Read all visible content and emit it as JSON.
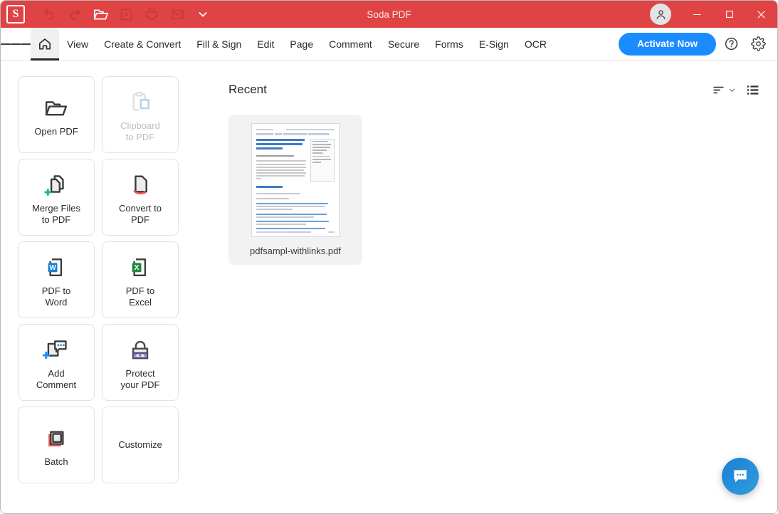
{
  "window": {
    "title": "Soda PDF",
    "app_badge": "S",
    "accent_red": "#e04344",
    "accent_blue": "#1a8cff",
    "minimize_label": "Minimize",
    "maximize_label": "Maximize",
    "close_label": "Close"
  },
  "quick_access": [
    {
      "name": "undo-icon",
      "label": "Undo",
      "enabled": false
    },
    {
      "name": "redo-icon",
      "label": "Redo",
      "enabled": false
    },
    {
      "name": "open-folder-icon",
      "label": "Open",
      "enabled": true
    },
    {
      "name": "save-icon",
      "label": "Save",
      "enabled": false
    },
    {
      "name": "print-icon",
      "label": "Print",
      "enabled": false
    },
    {
      "name": "mail-icon",
      "label": "Email",
      "enabled": false
    },
    {
      "name": "chevron-down-icon",
      "label": "More",
      "enabled": true
    }
  ],
  "ribbon": {
    "menu_label": "Menu",
    "home_label": "Home",
    "tabs": [
      {
        "label": "View"
      },
      {
        "label": "Create & Convert"
      },
      {
        "label": "Fill & Sign"
      },
      {
        "label": "Edit"
      },
      {
        "label": "Page"
      },
      {
        "label": "Comment"
      },
      {
        "label": "Secure"
      },
      {
        "label": "Forms"
      },
      {
        "label": "E-Sign"
      },
      {
        "label": "OCR"
      }
    ],
    "activate_label": "Activate Now",
    "help_label": "Help",
    "settings_label": "Settings"
  },
  "tools": [
    {
      "label": "Open PDF",
      "icon": "open-folder-icon",
      "disabled": false
    },
    {
      "label": "Clipboard\nto PDF",
      "icon": "clipboard-icon",
      "disabled": true
    },
    {
      "label": "Merge Files\nto PDF",
      "icon": "merge-files-icon",
      "disabled": false
    },
    {
      "label": "Convert to\nPDF",
      "icon": "convert-to-pdf-icon",
      "disabled": false
    },
    {
      "label": "PDF to\nWord",
      "icon": "word-icon",
      "disabled": false
    },
    {
      "label": "PDF to\nExcel",
      "icon": "excel-icon",
      "disabled": false
    },
    {
      "label": "Add\nComment",
      "icon": "add-comment-icon",
      "disabled": false
    },
    {
      "label": "Protect\nyour PDF",
      "icon": "lock-icon",
      "disabled": false
    },
    {
      "label": "Batch",
      "icon": "batch-icon",
      "disabled": false
    },
    {
      "label": "Customize",
      "icon": "",
      "disabled": false
    }
  ],
  "recent": {
    "title": "Recent",
    "sort_label": "Sort",
    "view_toggle_label": "List view",
    "files": [
      {
        "name": "pdfsampl-withlinks.pdf"
      }
    ]
  },
  "chat": {
    "label": "Chat"
  }
}
